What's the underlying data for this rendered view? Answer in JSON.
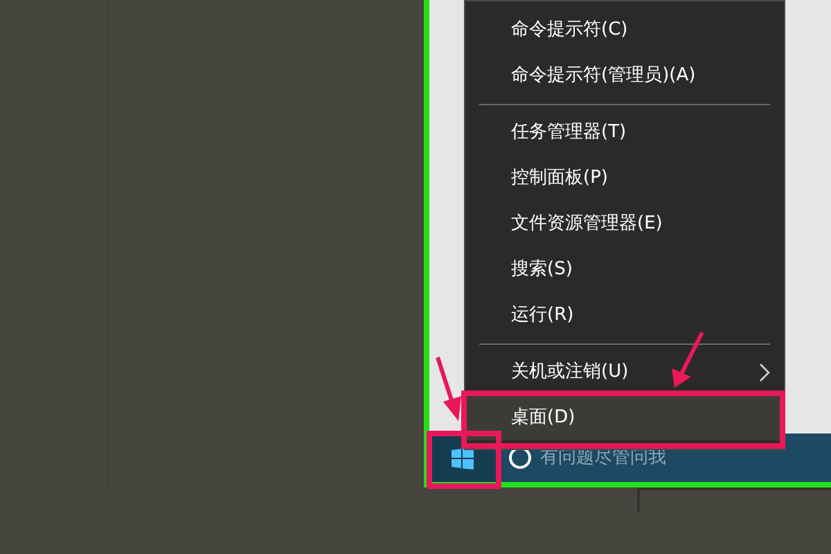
{
  "menu": {
    "items": [
      {
        "kind": "item",
        "label": "命令提示符(C)",
        "selected": false
      },
      {
        "kind": "item",
        "label": "命令提示符(管理员)(A)",
        "selected": false
      },
      {
        "kind": "separator"
      },
      {
        "kind": "item",
        "label": "任务管理器(T)",
        "selected": false
      },
      {
        "kind": "item",
        "label": "控制面板(P)",
        "selected": false
      },
      {
        "kind": "item",
        "label": "文件资源管理器(E)",
        "selected": false
      },
      {
        "kind": "item",
        "label": "搜索(S)",
        "selected": false
      },
      {
        "kind": "item",
        "label": "运行(R)",
        "selected": false
      },
      {
        "kind": "separator"
      },
      {
        "kind": "submenu",
        "label": "关机或注销(U)",
        "selected": false
      },
      {
        "kind": "item",
        "label": "桌面(D)",
        "selected": true
      }
    ]
  },
  "taskbar": {
    "search": {
      "placeholder": "有问题尽管问我"
    }
  }
}
